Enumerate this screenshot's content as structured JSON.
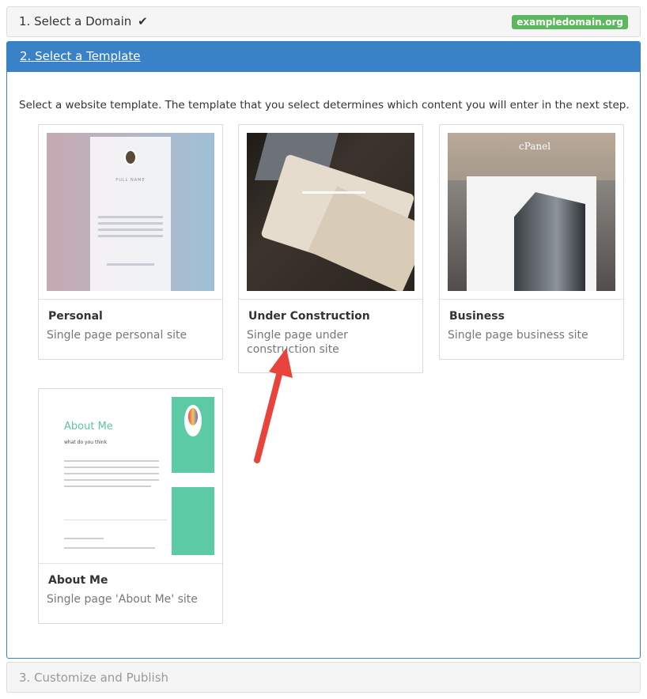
{
  "step1": {
    "title": "1. Select a Domain",
    "check_icon": "check-icon",
    "domain": "exampledomain.org"
  },
  "step2": {
    "title": "2. Select a Template",
    "intro": "Select a website template. The template that you select determines which content you will enter in the next step.",
    "templates": [
      {
        "name": "Personal",
        "description": "Single page personal site"
      },
      {
        "name": "Under Construction",
        "description": "Single page under construction site"
      },
      {
        "name": "Business",
        "description": "Single page business site"
      },
      {
        "name": "About Me",
        "description": "Single page 'About Me' site"
      }
    ],
    "thumbnails": {
      "personal_name": "FULL NAME",
      "business_logo": "cPanel",
      "about_heading": "About Me",
      "about_sub": "what do you think"
    }
  },
  "step3": {
    "title": "3. Customize and Publish"
  },
  "colors": {
    "accent": "#3a82c8",
    "badge": "#5cb85c",
    "arrow": "#e8443c"
  }
}
